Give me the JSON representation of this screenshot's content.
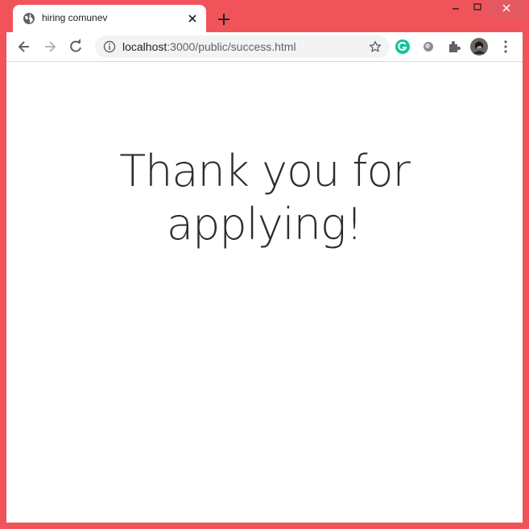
{
  "browser": {
    "tab": {
      "title": "hiring comunev",
      "favicon": "globe-icon"
    },
    "url": {
      "host": "localhost",
      "path": ":3000/public/success.html"
    },
    "icons": {
      "back": "arrow-left-icon",
      "forward": "arrow-right-icon",
      "reload": "reload-icon",
      "info": "info-icon",
      "bookmark": "star-icon",
      "grammarly": "grammarly-icon",
      "extension_circle": "extension-icon",
      "extensions": "puzzle-icon",
      "profile": "avatar",
      "menu": "kebab-menu-icon"
    },
    "colors": {
      "frame": "#f0545a",
      "grammarly": "#15c39a"
    }
  },
  "page": {
    "heading_line1": "Thank you for",
    "heading_line2": "applying!"
  }
}
